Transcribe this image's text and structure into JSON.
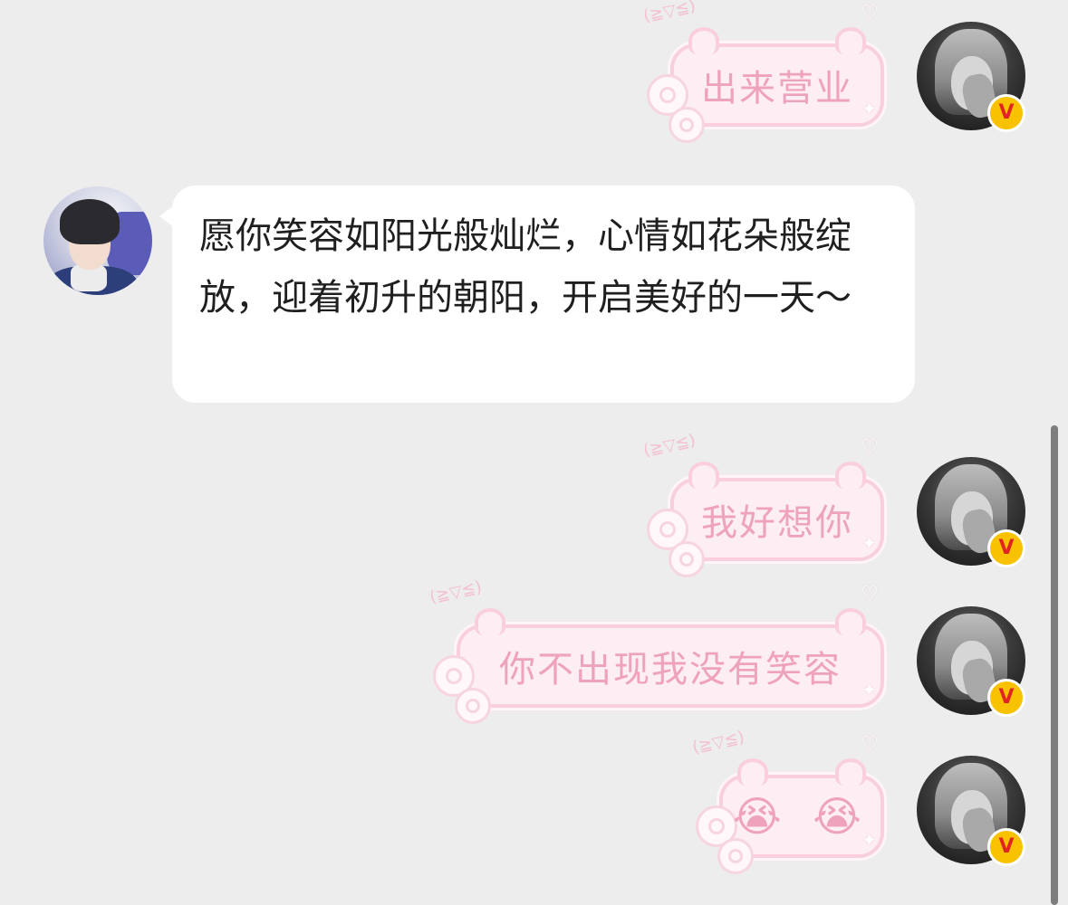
{
  "chat": {
    "messages": [
      {
        "sender": "self",
        "text": "出来营业",
        "kaomoji": "(≧▽≦)"
      },
      {
        "sender": "other",
        "text": "愿你笑容如阳光般灿烂，心情如花朵般绽放，迎着初升的朝阳，开启美好的一天～"
      },
      {
        "sender": "self",
        "text": "我好想你",
        "kaomoji": "(≧▽≦)"
      },
      {
        "sender": "self",
        "text": "你不出现我没有笑容",
        "kaomoji": "(≧▽≦)"
      },
      {
        "sender": "self",
        "text": "😭 😭",
        "kaomoji": "(≧▽≦)"
      }
    ],
    "verified_badge": "V"
  },
  "colors": {
    "background": "#ededed",
    "pink_bubble_fill": "#fdeef3",
    "pink_bubble_border": "#f9cfdd",
    "pink_text": "#eea2bc",
    "white_bubble": "#ffffff",
    "badge_yellow": "#f8c200",
    "badge_red": "#e0251f"
  },
  "icons": {
    "badge": "verified-v-icon",
    "flower": "flower-decoration-icon",
    "heart": "heart-decoration-icon",
    "sparkle": "sparkle-decoration-icon"
  }
}
